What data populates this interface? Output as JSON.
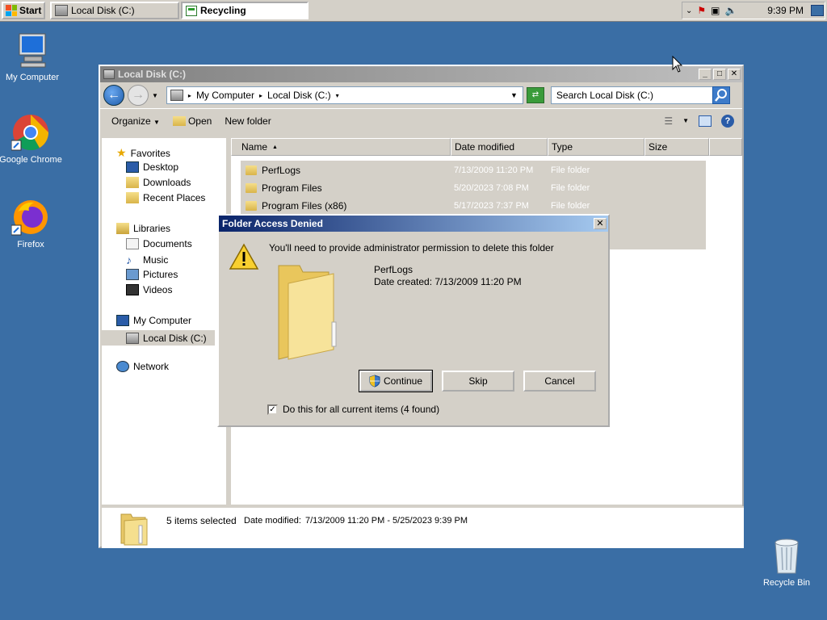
{
  "taskbar": {
    "start_label": "Start",
    "tasks": [
      {
        "label": "Local Disk (C:)"
      },
      {
        "label": "Recycling"
      }
    ],
    "clock": "9:39 PM"
  },
  "desktop": {
    "icons": [
      {
        "label": "My Computer"
      },
      {
        "label": "Google Chrome"
      },
      {
        "label": "Firefox"
      },
      {
        "label": "Recycle Bin"
      }
    ]
  },
  "explorer": {
    "title": "Local Disk (C:)",
    "breadcrumb": [
      "My Computer",
      "Local Disk (C:)"
    ],
    "search_placeholder": "Search Local Disk (C:)",
    "commands": {
      "organize": "Organize",
      "open": "Open",
      "new_folder": "New folder"
    },
    "nav": {
      "favorites": "Favorites",
      "desktop": "Desktop",
      "downloads": "Downloads",
      "recent": "Recent Places",
      "libraries": "Libraries",
      "documents": "Documents",
      "music": "Music",
      "pictures": "Pictures",
      "videos": "Videos",
      "my_computer": "My Computer",
      "local_disk": "Local Disk (C:)",
      "network": "Network"
    },
    "columns": {
      "name": "Name",
      "date": "Date modified",
      "type": "Type",
      "size": "Size"
    },
    "rows": [
      {
        "name": "PerfLogs",
        "date": "7/13/2009 11:20 PM",
        "type": "File folder"
      },
      {
        "name": "Program Files",
        "date": "5/20/2023 7:08 PM",
        "type": "File folder"
      },
      {
        "name": "Program Files (x86)",
        "date": "5/17/2023 7:37 PM",
        "type": "File folder"
      }
    ],
    "details": {
      "count": "5 items selected",
      "date_label": "Date modified:",
      "date_range": "7/13/2009 11:20 PM - 5/25/2023 9:39 PM"
    }
  },
  "dialog": {
    "title": "Folder Access Denied",
    "message": "You'll need to provide administrator permission to delete this folder",
    "folder_name": "PerfLogs",
    "folder_date": "Date created: 7/13/2009 11:20 PM",
    "continue_label": "Continue",
    "skip_label": "Skip",
    "cancel_label": "Cancel",
    "checkbox_label": "Do this for all current items (4 found)",
    "checkbox_checked": true
  }
}
